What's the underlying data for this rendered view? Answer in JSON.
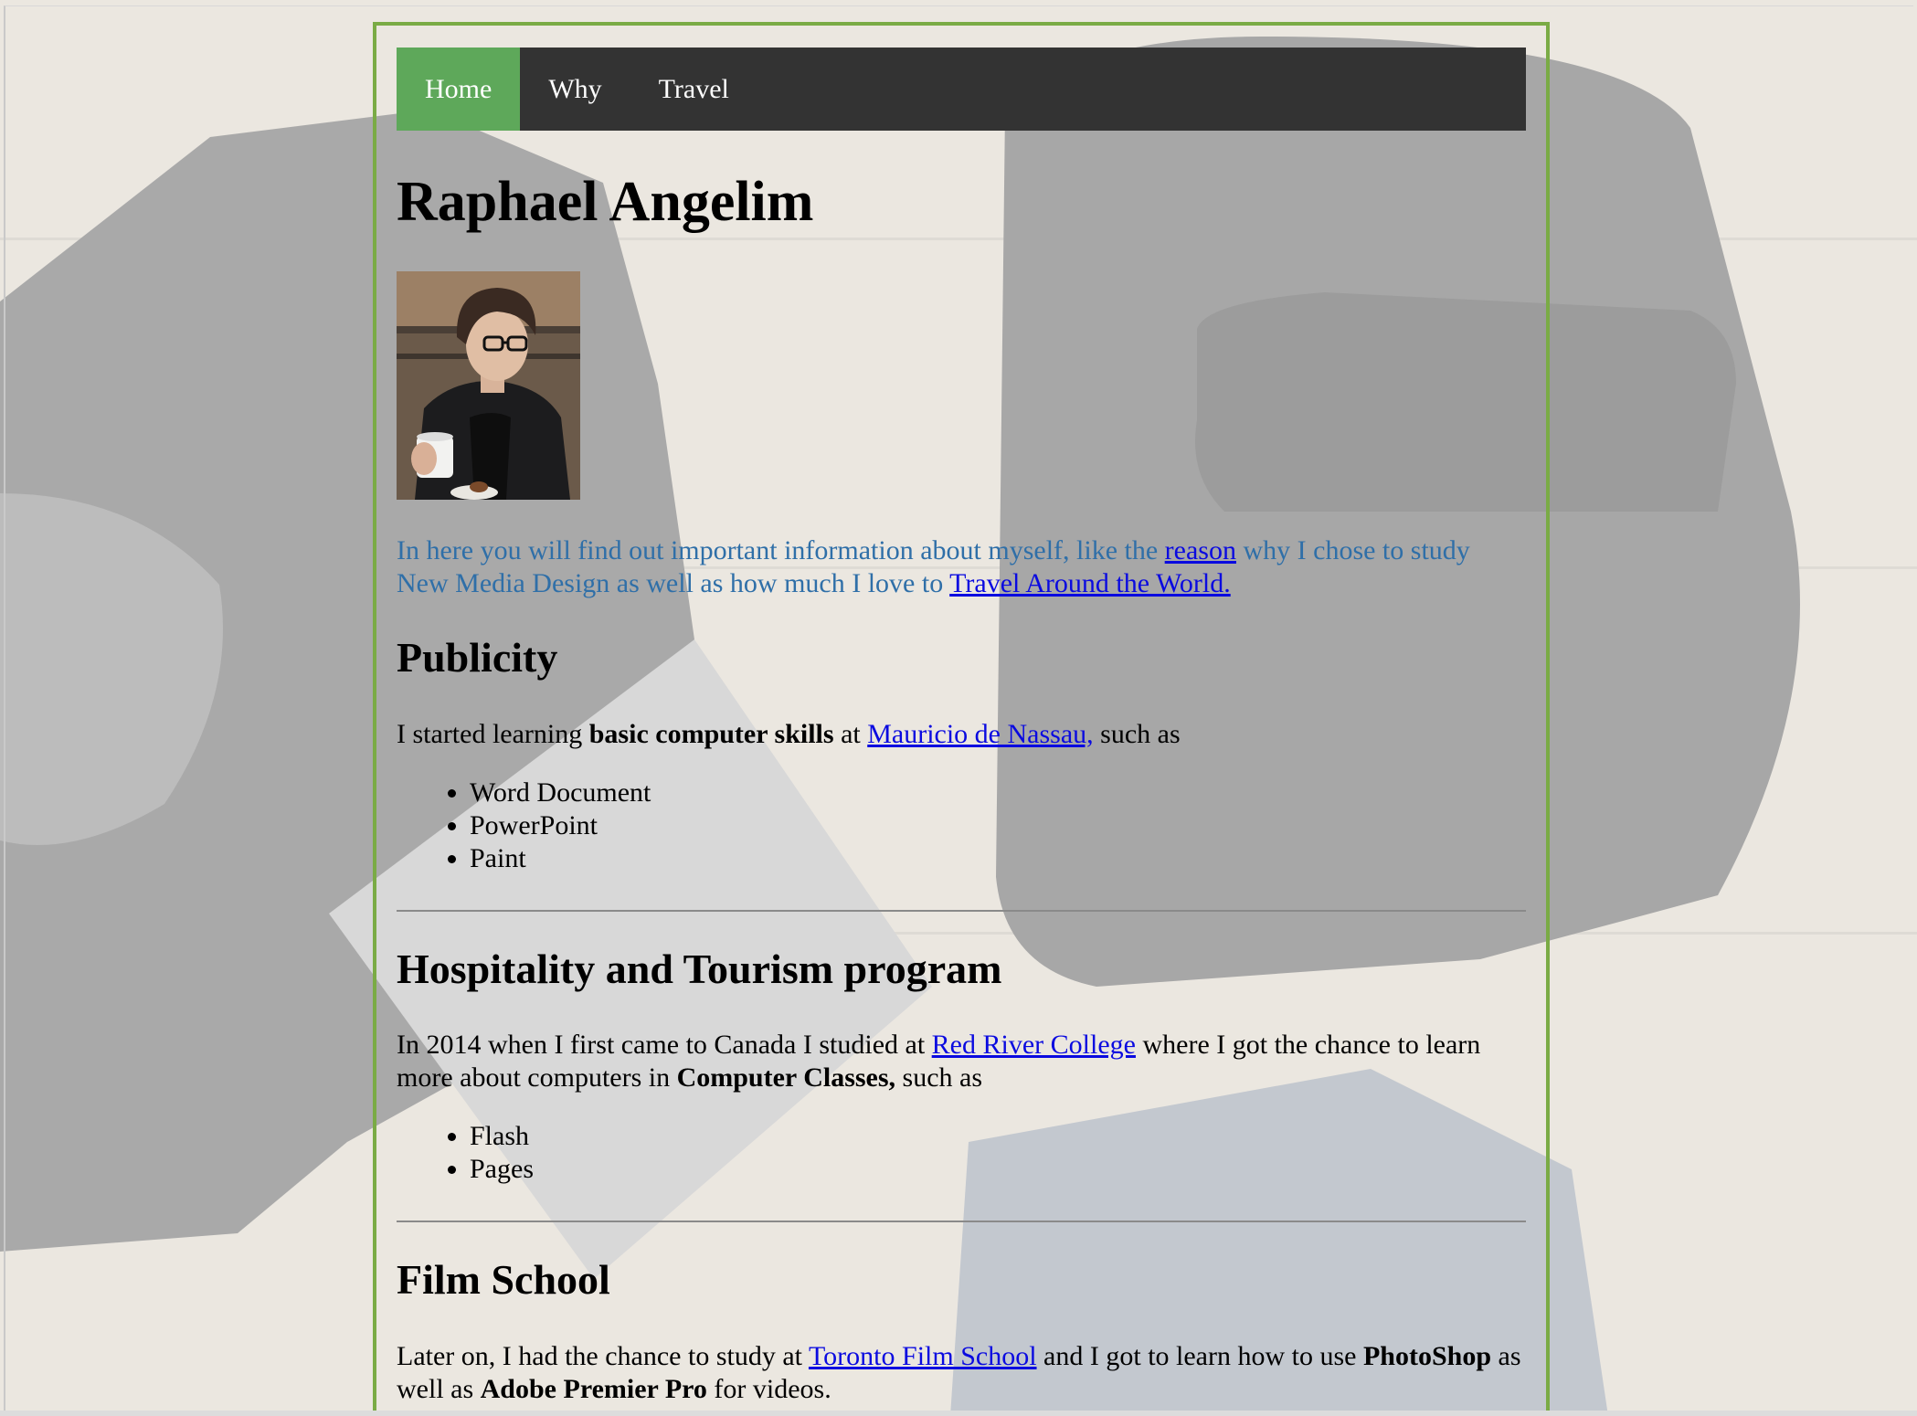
{
  "nav": {
    "items": [
      {
        "label": "Home"
      },
      {
        "label": "Why"
      },
      {
        "label": "Travel"
      }
    ]
  },
  "page_title": "Raphael Angelim",
  "intro": {
    "part1": "In here you will find out important information about myself, like the ",
    "link_reason": "reason",
    "part2": " why I chose to study New Media Design as well as how much I love to ",
    "link_travel": "Travel Around the World."
  },
  "publicity": {
    "heading": "Publicity",
    "text1": "I started learning ",
    "bold": "basic computer skills",
    "text2": " at ",
    "link": "Mauricio de Nassau,",
    "text3": " such as",
    "items": [
      "Word Document",
      "PowerPoint",
      "Paint"
    ]
  },
  "hospitality": {
    "heading": "Hospitality and Tourism program",
    "text1": "In 2014 when I first came to Canada I studied at ",
    "link": "Red River College",
    "text2": " where I got the chance to learn more about computers in ",
    "bold": "Computer Classes,",
    "text3": " such as",
    "items": [
      "Flash",
      "Pages"
    ]
  },
  "film": {
    "heading": "Film School",
    "text1": "Later on, I had the chance to study at ",
    "link": "Toronto Film School",
    "text2": " and I got to learn how to use ",
    "bold1": "PhotoShop",
    "text3": " as well as ",
    "bold2": "Adobe Premier Pro",
    "text4": " for videos."
  },
  "colors": {
    "nav_bg": "#333333",
    "nav_active": "#5ea85a",
    "frame_border": "#7aab45",
    "intro_text": "#2f6fa8",
    "link": "#0a0ae0"
  }
}
